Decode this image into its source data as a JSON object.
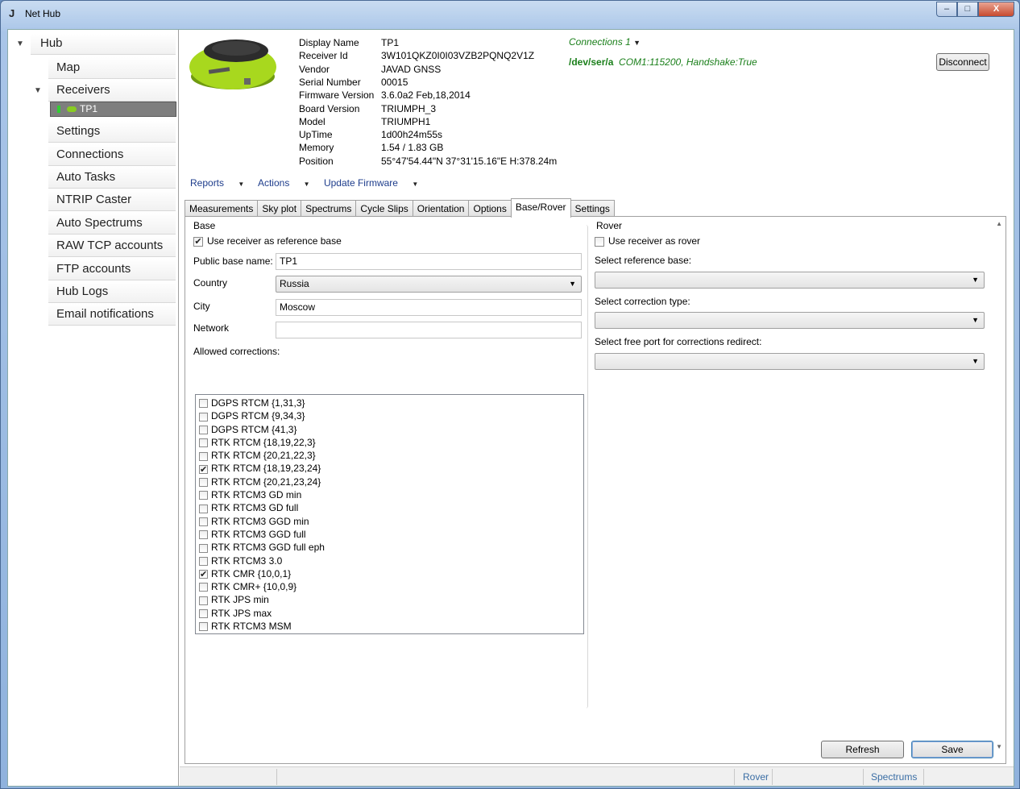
{
  "window": {
    "title": "Net Hub",
    "buttons": {
      "minimize": "–",
      "maximize": "□",
      "close": "X"
    }
  },
  "nav": {
    "root": "Hub",
    "items": [
      {
        "label": "Map"
      },
      {
        "label": "Receivers"
      },
      {
        "label": "Settings"
      },
      {
        "label": "Connections"
      },
      {
        "label": "Auto Tasks"
      },
      {
        "label": "NTRIP Caster"
      },
      {
        "label": "Auto Spectrums"
      },
      {
        "label": "RAW TCP accounts"
      },
      {
        "label": "FTP accounts"
      },
      {
        "label": "Hub Logs"
      },
      {
        "label": "Email notifications"
      }
    ],
    "receiver_node": "TP1"
  },
  "receiver_info": [
    {
      "label": "Display Name",
      "value": "TP1"
    },
    {
      "label": "Receiver Id",
      "value": "3W101QKZ0I0I03VZB2PQNQ2V1Z"
    },
    {
      "label": "Vendor",
      "value": "JAVAD GNSS"
    },
    {
      "label": "Serial Number",
      "value": "00015"
    },
    {
      "label": "Firmware Version",
      "value": "3.6.0a2 Feb,18,2014"
    },
    {
      "label": "Board Version",
      "value": "TRIUMPH_3"
    },
    {
      "label": "Model",
      "value": "TRIUMPH1"
    },
    {
      "label": "UpTime",
      "value": "1d00h24m55s"
    },
    {
      "label": "Memory",
      "value": "1.54 / 1.83 GB"
    },
    {
      "label": "Position",
      "value": "55°47'54.44\"N 37°31'15.16\"E H:378.24m"
    }
  ],
  "connections": {
    "label": "Connections",
    "count": "1",
    "port": "/dev/ser/a",
    "details": "COM1:115200, Handshake:True",
    "disconnect_label": "Disconnect"
  },
  "menus": [
    "Reports",
    "Actions",
    "Update Firmware"
  ],
  "tabs": [
    {
      "label": "Measurements",
      "active": false
    },
    {
      "label": "Sky plot",
      "active": false
    },
    {
      "label": "Spectrums",
      "active": false
    },
    {
      "label": "Cycle Slips",
      "active": false
    },
    {
      "label": "Orientation",
      "active": false
    },
    {
      "label": "Options",
      "active": false
    },
    {
      "label": "Base/Rover",
      "active": true
    },
    {
      "label": "Settings",
      "active": false
    }
  ],
  "base": {
    "legend": "Base",
    "use_as_base_label": "Use receiver as reference base",
    "use_as_base_checked": true,
    "public_name_label": "Public base name:",
    "public_name_value": "TP1",
    "country_label": "Country",
    "country_value": "Russia",
    "city_label": "City",
    "city_value": "Moscow",
    "network_label": "Network",
    "network_value": "",
    "allowed_label": "Allowed corrections:",
    "corrections": [
      {
        "label": "DGPS RTCM {1,31,3}",
        "checked": false
      },
      {
        "label": "DGPS RTCM {9,34,3}",
        "checked": false
      },
      {
        "label": "DGPS RTCM {41,3}",
        "checked": false
      },
      {
        "label": "RTK RTCM {18,19,22,3}",
        "checked": false
      },
      {
        "label": "RTK RTCM {20,21,22,3}",
        "checked": false
      },
      {
        "label": "RTK RTCM {18,19,23,24}",
        "checked": true
      },
      {
        "label": "RTK RTCM {20,21,23,24}",
        "checked": false
      },
      {
        "label": "RTK RTCM3 GD min",
        "checked": false
      },
      {
        "label": "RTK RTCM3 GD full",
        "checked": false
      },
      {
        "label": "RTK RTCM3 GGD min",
        "checked": false
      },
      {
        "label": "RTK RTCM3 GGD full",
        "checked": false
      },
      {
        "label": "RTK RTCM3 GGD full eph",
        "checked": false
      },
      {
        "label": "RTK RTCM3 3.0",
        "checked": false
      },
      {
        "label": "RTK CMR {10,0,1}",
        "checked": true
      },
      {
        "label": "RTK CMR+ {10,0,9}",
        "checked": false
      },
      {
        "label": "RTK JPS min",
        "checked": false
      },
      {
        "label": "RTK JPS max",
        "checked": false
      },
      {
        "label": "RTK RTCM3 MSM",
        "checked": false
      }
    ]
  },
  "rover": {
    "legend": "Rover",
    "use_as_rover_label": "Use receiver as rover",
    "use_as_rover_checked": false,
    "select_base_label": "Select reference base:",
    "select_correction_label": "Select correction type:",
    "select_port_label": "Select free port for corrections redirect:"
  },
  "actions": {
    "refresh_label": "Refresh",
    "save_label": "Save"
  },
  "status_bar": {
    "rover": "Rover",
    "spectrums": "Spectrums"
  }
}
